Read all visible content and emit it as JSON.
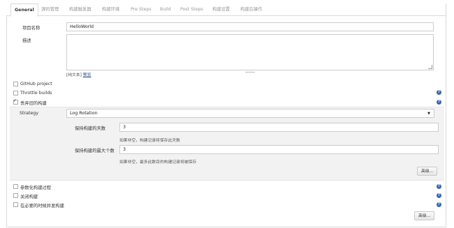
{
  "tabs": [
    "General",
    "源码管理",
    "构建触发器",
    "构建环境",
    "Pre Steps",
    "Build",
    "Post Steps",
    "构建设置",
    "构建后操作"
  ],
  "project_name": {
    "label": "项目名称",
    "value": "HelloWorld"
  },
  "description": {
    "label": "描述",
    "value": ""
  },
  "format_hint": {
    "plain_text": "[纯文本]",
    "preview": "预览"
  },
  "options": {
    "github_project": {
      "label": "GitHub project",
      "checked": false
    },
    "throttle_builds": {
      "label": "Throttle builds",
      "checked": false
    },
    "discard_old_builds": {
      "label": "丢弃旧的构建",
      "checked": true
    }
  },
  "strategy": {
    "label": "Strategy",
    "selected": "Log Rotation",
    "days_to_keep": {
      "label": "保持构建的天数",
      "value": "3",
      "hint": "如果非空，构建记录将保存此天数"
    },
    "max_builds": {
      "label": "保持构建的最大个数",
      "value": "3",
      "hint": "如果非空，最多此数目的构建记录将被保存"
    },
    "advanced_label": "高级..."
  },
  "more_options": {
    "parameterized": {
      "label": "参数化构建过程",
      "checked": false
    },
    "disable_build": {
      "label": "关闭构建",
      "checked": false
    },
    "concurrent": {
      "label": "在必要的时候并发构建",
      "checked": false
    }
  },
  "advanced_bottom_label": "高级...",
  "help_icon_glyph": "?",
  "colors": {
    "help": "#3a66b0",
    "section_bg": "#f2f2f2",
    "link": "#204a87"
  }
}
